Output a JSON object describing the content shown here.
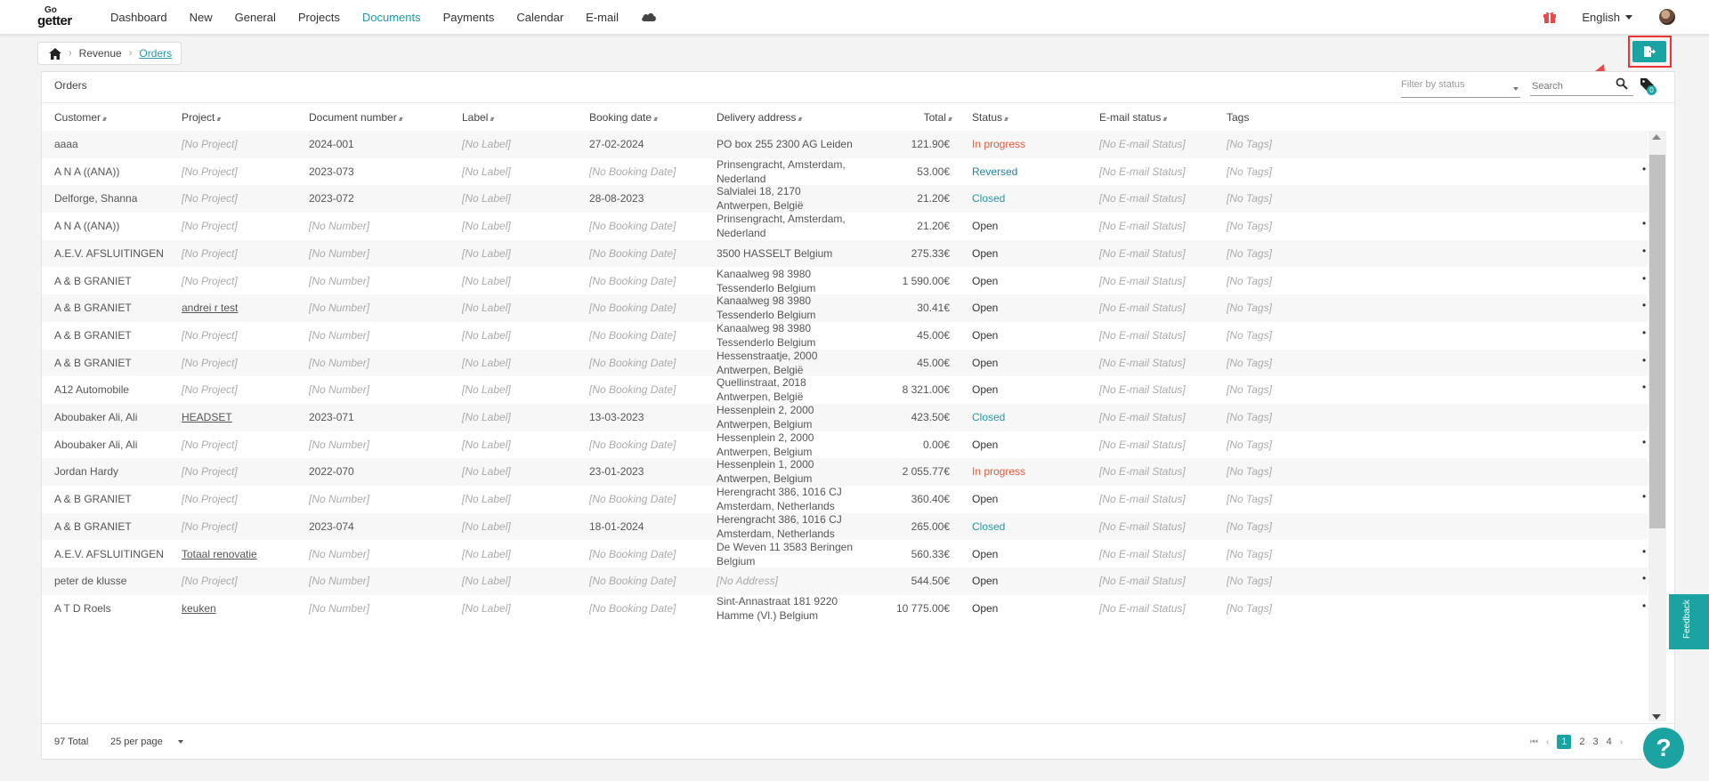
{
  "nav": {
    "logo_go": "Go",
    "logo_getter": "getter",
    "items": [
      {
        "label": "Dashboard",
        "active": false
      },
      {
        "label": "New",
        "active": false
      },
      {
        "label": "General",
        "active": false
      },
      {
        "label": "Projects",
        "active": false
      },
      {
        "label": "Documents",
        "active": true
      },
      {
        "label": "Payments",
        "active": false
      },
      {
        "label": "Calendar",
        "active": false
      },
      {
        "label": "E-mail",
        "active": false
      }
    ],
    "cloud_icon": "cloud-icon",
    "gift_icon": "gift-icon",
    "language": "English",
    "accent_color": "#1aa3a0"
  },
  "breadcrumb": {
    "home_icon": "home-icon",
    "items": [
      "Revenue",
      "Orders"
    ]
  },
  "toolbar": {
    "export_icon": "export-file-icon",
    "highlight_color": "#e33333"
  },
  "card": {
    "title": "Orders",
    "filter_placeholder": "Filter by status",
    "search_placeholder": "Search",
    "tag_badge": "0"
  },
  "columns": [
    "Customer",
    "Project",
    "Document number",
    "Label",
    "Booking date",
    "Delivery address",
    "Total",
    "Status",
    "E-mail status",
    "Tags"
  ],
  "rows": [
    {
      "customer": "aaaa",
      "project": "[No Project]",
      "docnum": "2024-001",
      "label": "[No Label]",
      "date": "27-02-2024",
      "addr1": "PO box 255 2300 AG Leiden",
      "addr2": "",
      "total": "121.90€",
      "status": "In progress",
      "email": "[No E-mail Status]",
      "tags": "[No Tags]",
      "dot": false
    },
    {
      "customer": "A N A ((ANA))",
      "project": "[No Project]",
      "docnum": "2023-073",
      "label": "[No Label]",
      "date": "[No Booking Date]",
      "addr1": "Prinsengracht, Amsterdam,",
      "addr2": "Nederland",
      "total": "53.00€",
      "status": "Reversed",
      "email": "[No E-mail Status]",
      "tags": "[No Tags]",
      "dot": true
    },
    {
      "customer": "Delforge, Shanna",
      "project": "[No Project]",
      "docnum": "2023-072",
      "label": "[No Label]",
      "date": "28-08-2023",
      "addr1": "Salvialei 18, 2170",
      "addr2": "Antwerpen, België",
      "total": "21.20€",
      "status": "Closed",
      "email": "[No E-mail Status]",
      "tags": "[No Tags]",
      "dot": false
    },
    {
      "customer": "A N A ((ANA))",
      "project": "[No Project]",
      "docnum": "[No Number]",
      "label": "[No Label]",
      "date": "[No Booking Date]",
      "addr1": "Prinsengracht, Amsterdam,",
      "addr2": "Nederland",
      "total": "21.20€",
      "status": "Open",
      "email": "[No E-mail Status]",
      "tags": "[No Tags]",
      "dot": true
    },
    {
      "customer": "A.E.V. AFSLUITINGEN",
      "project": "[No Project]",
      "docnum": "[No Number]",
      "label": "[No Label]",
      "date": "[No Booking Date]",
      "addr1": "3500 HASSELT Belgium",
      "addr2": "",
      "total": "275.33€",
      "status": "Open",
      "email": "[No E-mail Status]",
      "tags": "[No Tags]",
      "dot": true
    },
    {
      "customer": "A & B GRANIET",
      "project": "[No Project]",
      "docnum": "[No Number]",
      "label": "[No Label]",
      "date": "[No Booking Date]",
      "addr1": "Kanaalweg 98 3980",
      "addr2": "Tessenderlo Belgium",
      "total": "1 590.00€",
      "status": "Open",
      "email": "[No E-mail Status]",
      "tags": "[No Tags]",
      "dot": true
    },
    {
      "customer": "A & B GRANIET",
      "project": "andrei r test",
      "docnum": "[No Number]",
      "label": "[No Label]",
      "date": "[No Booking Date]",
      "addr1": "Kanaalweg 98 3980",
      "addr2": "Tessenderlo Belgium",
      "total": "30.41€",
      "status": "Open",
      "email": "[No E-mail Status]",
      "tags": "[No Tags]",
      "dot": true
    },
    {
      "customer": "A & B GRANIET",
      "project": "[No Project]",
      "docnum": "[No Number]",
      "label": "[No Label]",
      "date": "[No Booking Date]",
      "addr1": "Kanaalweg 98 3980",
      "addr2": "Tessenderlo Belgium",
      "total": "45.00€",
      "status": "Open",
      "email": "[No E-mail Status]",
      "tags": "[No Tags]",
      "dot": true
    },
    {
      "customer": "A & B GRANIET",
      "project": "[No Project]",
      "docnum": "[No Number]",
      "label": "[No Label]",
      "date": "[No Booking Date]",
      "addr1": "Hessenstraatje, 2000",
      "addr2": "Antwerpen, België",
      "total": "45.00€",
      "status": "Open",
      "email": "[No E-mail Status]",
      "tags": "[No Tags]",
      "dot": true
    },
    {
      "customer": "A12 Automobile",
      "project": "[No Project]",
      "docnum": "[No Number]",
      "label": "[No Label]",
      "date": "[No Booking Date]",
      "addr1": "Quellinstraat, 2018",
      "addr2": "Antwerpen, België",
      "total": "8 321.00€",
      "status": "Open",
      "email": "[No E-mail Status]",
      "tags": "[No Tags]",
      "dot": true
    },
    {
      "customer": "Aboubaker Ali, Ali",
      "project": "HEADSET",
      "docnum": "2023-071",
      "label": "[No Label]",
      "date": "13-03-2023",
      "addr1": "Hessenplein 2, 2000",
      "addr2": "Antwerpen, Belgium",
      "total": "423.50€",
      "status": "Closed",
      "email": "[No E-mail Status]",
      "tags": "[No Tags]",
      "dot": false
    },
    {
      "customer": "Aboubaker Ali, Ali",
      "project": "[No Project]",
      "docnum": "[No Number]",
      "label": "[No Label]",
      "date": "[No Booking Date]",
      "addr1": "Hessenplein 2, 2000",
      "addr2": "Antwerpen, Belgium",
      "total": "0.00€",
      "status": "Open",
      "email": "[No E-mail Status]",
      "tags": "[No Tags]",
      "dot": true
    },
    {
      "customer": "Jordan Hardy",
      "project": "[No Project]",
      "docnum": "2022-070",
      "label": "[No Label]",
      "date": "23-01-2023",
      "addr1": "Hessenplein 1, 2000",
      "addr2": "Antwerpen, Belgium",
      "total": "2 055.77€",
      "status": "In progress",
      "email": "[No E-mail Status]",
      "tags": "[No Tags]",
      "dot": false
    },
    {
      "customer": "A & B GRANIET",
      "project": "[No Project]",
      "docnum": "[No Number]",
      "label": "[No Label]",
      "date": "[No Booking Date]",
      "addr1": "Herengracht 386, 1016 CJ",
      "addr2": "Amsterdam, Netherlands",
      "total": "360.40€",
      "status": "Open",
      "email": "[No E-mail Status]",
      "tags": "[No Tags]",
      "dot": true
    },
    {
      "customer": "A & B GRANIET",
      "project": "[No Project]",
      "docnum": "2023-074",
      "label": "[No Label]",
      "date": "18-01-2024",
      "addr1": "Herengracht 386, 1016 CJ",
      "addr2": "Amsterdam, Netherlands",
      "total": "265.00€",
      "status": "Closed",
      "email": "[No E-mail Status]",
      "tags": "[No Tags]",
      "dot": false
    },
    {
      "customer": "A.E.V. AFSLUITINGEN",
      "project": "Totaal renovatie",
      "docnum": "[No Number]",
      "label": "[No Label]",
      "date": "[No Booking Date]",
      "addr1": "De Weven 11 3583 Beringen",
      "addr2": "Belgium",
      "total": "560.33€",
      "status": "Open",
      "email": "[No E-mail Status]",
      "tags": "[No Tags]",
      "dot": true
    },
    {
      "customer": "peter de klusse",
      "project": "[No Project]",
      "docnum": "[No Number]",
      "label": "[No Label]",
      "date": "[No Booking Date]",
      "addr1": "[No Address]",
      "addr2": "",
      "total": "544.50€",
      "status": "Open",
      "email": "[No E-mail Status]",
      "tags": "[No Tags]",
      "dot": true
    },
    {
      "customer": "A T D Roels",
      "project": "keuken",
      "docnum": "[No Number]",
      "label": "[No Label]",
      "date": "[No Booking Date]",
      "addr1": "Sint-Annastraat 181 9220",
      "addr2": "Hamme (Vl.) Belgium",
      "total": "10 775.00€",
      "status": "Open",
      "email": "[No E-mail Status]",
      "tags": "[No Tags]",
      "dot": true
    }
  ],
  "footer": {
    "total": "97 Total",
    "per_page": "25 per page",
    "pages": [
      "1",
      "2",
      "3",
      "4"
    ],
    "current_page": "1"
  },
  "feedback_label": "Feedback",
  "help_label": "?"
}
